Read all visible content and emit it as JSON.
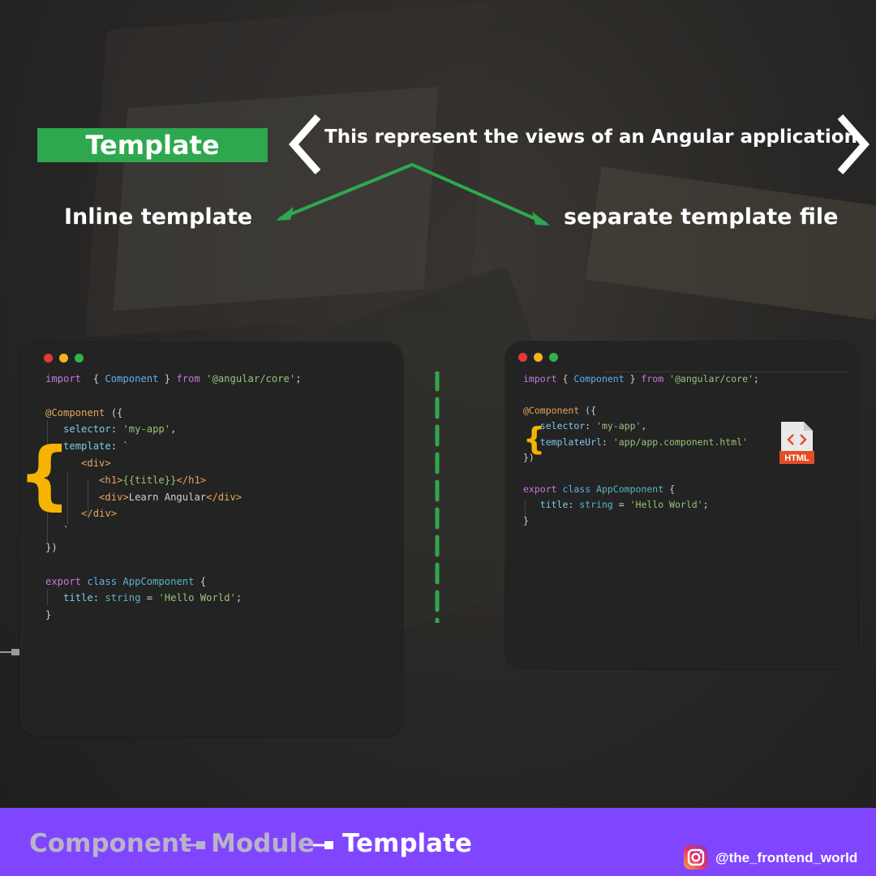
{
  "header": {
    "title": "Template",
    "subtitle": "This represent the views of an Angular application.",
    "left_branch": "Inline template",
    "right_branch": "separate template file"
  },
  "inline_code": {
    "lines": [
      [
        [
          "kw",
          "import"
        ],
        [
          "",
          "  { "
        ],
        [
          "id",
          "Component"
        ],
        [
          "",
          " } "
        ],
        [
          "kw",
          "from"
        ],
        [
          "",
          " "
        ],
        [
          "str",
          "'@angular/core'"
        ],
        [
          "",
          ";"
        ]
      ],
      [],
      [
        [
          "tag",
          "@Component"
        ],
        [
          "",
          " ({"
        ]
      ],
      [
        [
          "",
          "   "
        ],
        [
          "prop",
          "selector"
        ],
        [
          "",
          ": "
        ],
        [
          "str",
          "'my-app'"
        ],
        [
          "",
          ","
        ]
      ],
      [
        [
          "",
          "   "
        ],
        [
          "prop",
          "template"
        ],
        [
          "",
          ": `"
        ]
      ],
      [
        [
          "",
          "      "
        ],
        [
          "tag",
          "<div>"
        ]
      ],
      [
        [
          "",
          "         "
        ],
        [
          "tag",
          "<h1>"
        ],
        [
          "str",
          "{{title}}"
        ],
        [
          "tag",
          "</h1>"
        ]
      ],
      [
        [
          "",
          "         "
        ],
        [
          "tag",
          "<div>"
        ],
        [
          "",
          "Learn Angular"
        ],
        [
          "tag",
          "</div>"
        ]
      ],
      [
        [
          "",
          "      "
        ],
        [
          "tag",
          "</div>"
        ]
      ],
      [
        [
          "",
          "   `"
        ]
      ],
      [
        [
          "",
          "})"
        ]
      ],
      [],
      [
        [
          "kw",
          "export"
        ],
        [
          "",
          " "
        ],
        [
          "id",
          "class"
        ],
        [
          "",
          " "
        ],
        [
          "cls",
          "AppComponent"
        ],
        [
          "",
          " {"
        ]
      ],
      [
        [
          "",
          "   "
        ],
        [
          "prop",
          "title"
        ],
        [
          "",
          ": "
        ],
        [
          "cls",
          "string"
        ],
        [
          "",
          " = "
        ],
        [
          "str",
          "'Hello World'"
        ],
        [
          "",
          ";"
        ]
      ],
      [
        [
          "",
          "}"
        ]
      ]
    ]
  },
  "separate_code": {
    "lines": [
      [
        [
          "kw",
          "import"
        ],
        [
          "",
          " { "
        ],
        [
          "id",
          "Component"
        ],
        [
          "",
          " } "
        ],
        [
          "kw",
          "from"
        ],
        [
          "",
          " "
        ],
        [
          "str",
          "'@angular/core'"
        ],
        [
          "",
          ";"
        ]
      ],
      [],
      [
        [
          "tag",
          "@Component"
        ],
        [
          "",
          " ({"
        ]
      ],
      [
        [
          "",
          "   "
        ],
        [
          "prop",
          "selector"
        ],
        [
          "",
          ": "
        ],
        [
          "str",
          "'my-app'"
        ],
        [
          "",
          ","
        ]
      ],
      [
        [
          "",
          "   "
        ],
        [
          "prop",
          "templateUrl"
        ],
        [
          "",
          ": "
        ],
        [
          "str",
          "'app/app.component.html'"
        ]
      ],
      [
        [
          "",
          "})"
        ]
      ],
      [],
      [
        [
          "kw",
          "export"
        ],
        [
          "",
          " "
        ],
        [
          "id",
          "class"
        ],
        [
          "",
          " "
        ],
        [
          "cls",
          "AppComponent"
        ],
        [
          "",
          " {"
        ]
      ],
      [
        [
          "",
          "   "
        ],
        [
          "prop",
          "title"
        ],
        [
          "",
          ": "
        ],
        [
          "cls",
          "string"
        ],
        [
          "",
          " = "
        ],
        [
          "str",
          "'Hello World'"
        ],
        [
          "",
          ";"
        ]
      ],
      [
        [
          "",
          "}"
        ]
      ]
    ]
  },
  "html_icon_label": "HTML",
  "footer": {
    "crumbs": [
      "Component",
      "Module",
      "Template"
    ],
    "handle": "@the_frontend_world"
  },
  "colors": {
    "accent_green": "#2ea84f",
    "brace_yellow": "#f4b400",
    "footer_purple": "#8046ff"
  },
  "icons": [
    "chevron-left-icon",
    "chevron-right-icon",
    "html-file-icon",
    "instagram-icon"
  ]
}
